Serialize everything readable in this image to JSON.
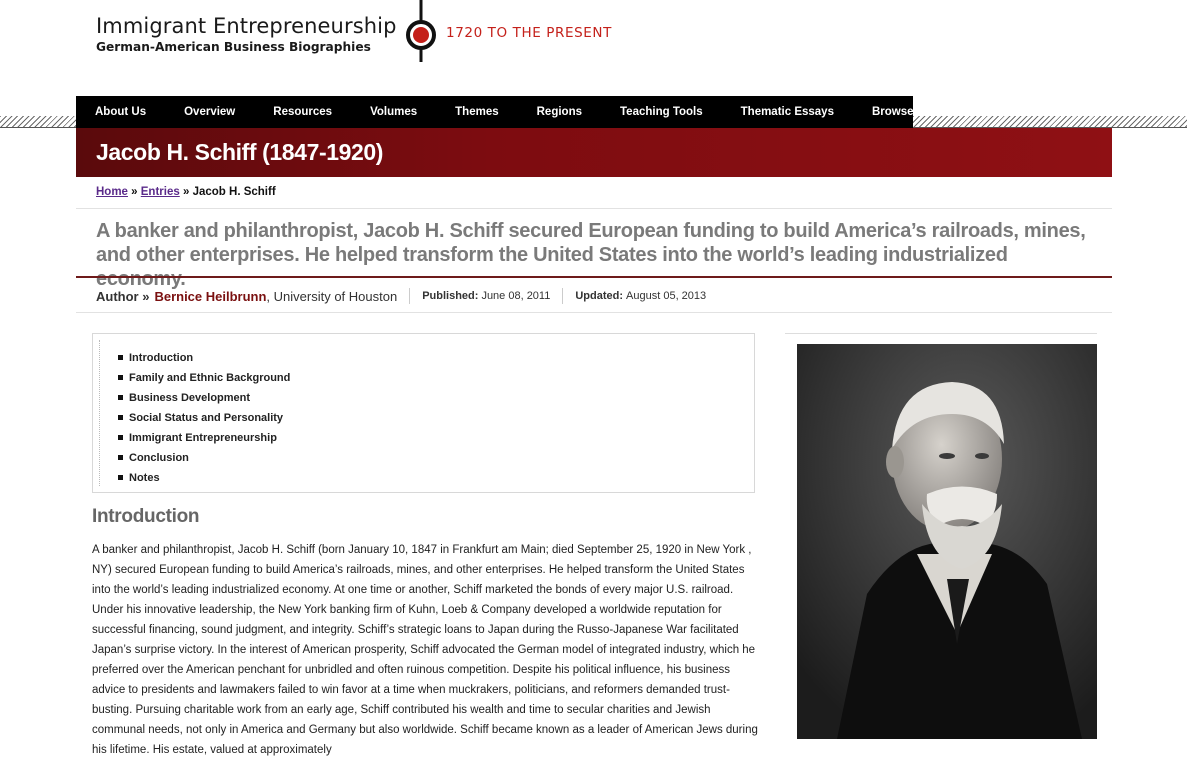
{
  "site": {
    "title": "Immigrant Entrepreneurship",
    "subtitle": "German-American Business Biographies",
    "tagline": "1720 TO THE PRESENT"
  },
  "nav": [
    {
      "label": "About Us"
    },
    {
      "label": "Overview"
    },
    {
      "label": "Resources"
    },
    {
      "label": "Volumes"
    },
    {
      "label": "Themes"
    },
    {
      "label": "Regions"
    },
    {
      "label": "Teaching Tools"
    },
    {
      "label": "Thematic Essays"
    },
    {
      "label": "Browse"
    }
  ],
  "page_title": "Jacob H. Schiff (1847-1920)",
  "breadcrumb": {
    "home": "Home",
    "sep": "»",
    "entries": "Entries",
    "current": "Jacob H. Schiff"
  },
  "lede": "A banker and philanthropist, Jacob H. Schiff secured European funding to build America’s railroads, mines, and other enterprises. He helped transform the United States into the world’s leading industrialized economy.",
  "meta": {
    "author_label": "Author »",
    "author_name": "Bernice Heilbrunn",
    "institution": ", University of Houston",
    "published_label": "Published:",
    "published_date": "June 08, 2011",
    "updated_label": "Updated:",
    "updated_date": "August 05, 2013"
  },
  "toc": [
    "Introduction",
    "Family and Ethnic Background",
    "Business Development",
    "Social Status and Personality",
    "Immigrant Entrepreneurship",
    "Conclusion",
    "Notes"
  ],
  "section_heading": "Introduction",
  "article_text": "A banker and philanthropist, Jacob H. Schiff (born January 10, 1847 in Frankfurt am Main; died September 25, 1920 in New York , NY) secured European funding to build America’s railroads, mines, and other enterprises. He helped transform the United States into the world’s leading industrialized economy. At one time or another, Schiff marketed the bonds of every major U.S. railroad. Under his innovative leadership, the New York banking firm of Kuhn, Loeb & Company developed a worldwide reputation for successful financing, sound judgment, and integrity. Schiff’s strategic loans to Japan during the Russo-Japanese War facilitated Japan’s surprise victory. In the interest of American prosperity, Schiff advocated the German model of integrated industry, which he preferred over the American penchant for unbridled and often ruinous competition. Despite his political influence, his business advice to presidents and lawmakers failed to win favor at a time when muckrakers, politicians, and reformers demanded trust-busting. Pursuing charitable work from an early age, Schiff contributed his wealth and time to secular charities and Jewish communal needs, not only in America and Germany but also worldwide. Schiff became known as a leader of American Jews during his lifetime. His estate, valued at approximately",
  "colors": {
    "brand_red": "#c4201a",
    "banner_dark": "#5a0a0c",
    "banner_light": "#8f1014",
    "nav_bg": "#000000",
    "link_purple": "#5a2a8a",
    "author_red": "#7a1010"
  }
}
